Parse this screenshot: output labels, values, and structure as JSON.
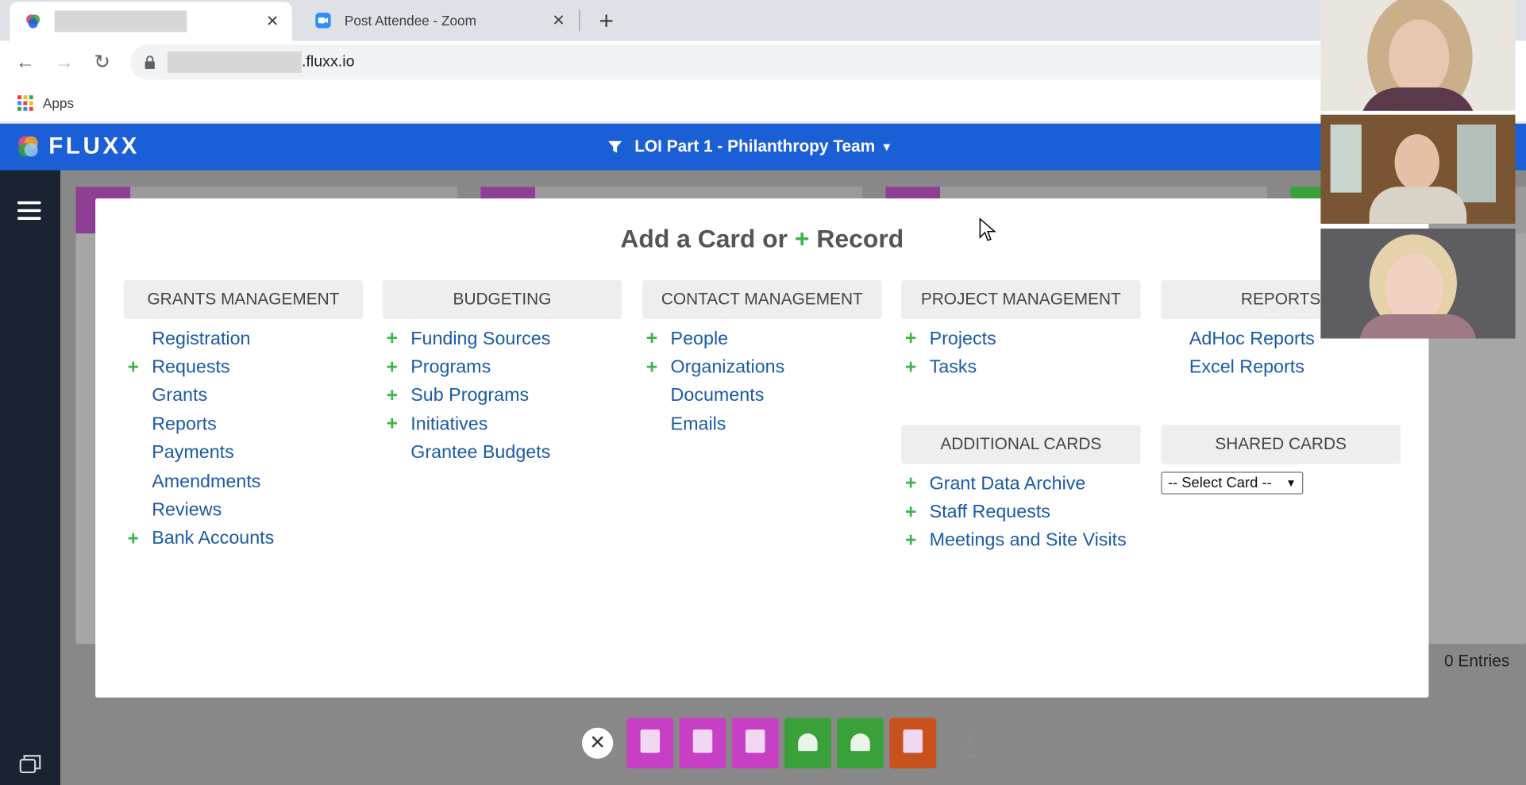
{
  "browser": {
    "tabs": [
      {
        "title": "",
        "active": true
      },
      {
        "title": "Post Attendee - Zoom",
        "active": false
      }
    ],
    "address": {
      "domain_suffix": ".fluxx.io"
    },
    "bookmarks": {
      "apps_label": "Apps"
    }
  },
  "app": {
    "logo_text": "FLUXX",
    "dashboard_title": "LOI Part 1 - Philanthropy Team",
    "entries_label": "0 Entries"
  },
  "modal": {
    "title_prefix": "Add a Card or",
    "title_plus": "+",
    "title_suffix": "Record",
    "columns": [
      {
        "header": "GRANTS MANAGEMENT",
        "items": [
          {
            "label": "Registration",
            "plus": false
          },
          {
            "label": "Requests",
            "plus": true
          },
          {
            "label": "Grants",
            "plus": false
          },
          {
            "label": "Reports",
            "plus": false
          },
          {
            "label": "Payments",
            "plus": false
          },
          {
            "label": "Amendments",
            "plus": false
          },
          {
            "label": "Reviews",
            "plus": false
          },
          {
            "label": "Bank Accounts",
            "plus": true
          }
        ]
      },
      {
        "header": "BUDGETING",
        "items": [
          {
            "label": "Funding Sources",
            "plus": true
          },
          {
            "label": "Programs",
            "plus": true
          },
          {
            "label": "Sub Programs",
            "plus": true
          },
          {
            "label": "Initiatives",
            "plus": true
          },
          {
            "label": "Grantee Budgets",
            "plus": false
          }
        ]
      },
      {
        "header": "CONTACT MANAGEMENT",
        "items": [
          {
            "label": "People",
            "plus": true
          },
          {
            "label": "Organizations",
            "plus": true
          },
          {
            "label": "Documents",
            "plus": false
          },
          {
            "label": "Emails",
            "plus": false
          }
        ]
      },
      {
        "header": "PROJECT MANAGEMENT",
        "items": [
          {
            "label": "Projects",
            "plus": true
          },
          {
            "label": "Tasks",
            "plus": true
          }
        ]
      },
      {
        "header": "REPORTS",
        "items": [
          {
            "label": "AdHoc Reports",
            "plus": false
          },
          {
            "label": "Excel Reports",
            "plus": false
          }
        ]
      },
      {
        "header": "ADDITIONAL CARDS",
        "items": [
          {
            "label": "Grant Data Archive",
            "plus": true
          },
          {
            "label": "Staff Requests",
            "plus": true
          },
          {
            "label": "Meetings and Site Visits",
            "plus": true
          }
        ]
      },
      {
        "header": "SHARED CARDS",
        "select": "-- Select Card --"
      }
    ]
  },
  "colors": {
    "brand_blue": "#1b5fd6",
    "link_blue": "#1b5aa6",
    "plus_green": "#3bb54a",
    "dock_magenta": "#c63fc4",
    "dock_green": "#3aa13a",
    "dock_orange": "#c9511d"
  },
  "dock": {
    "buttons": [
      {
        "icon": "download-doc-icon",
        "color": "#c63fc4"
      },
      {
        "icon": "download-doc-icon",
        "color": "#c63fc4"
      },
      {
        "icon": "download-doc-icon",
        "color": "#c63fc4"
      },
      {
        "icon": "bell-icon",
        "color": "#3aa13a"
      },
      {
        "icon": "bell-icon",
        "color": "#3aa13a"
      },
      {
        "icon": "checked-doc-icon",
        "color": "#c9511d"
      }
    ]
  }
}
